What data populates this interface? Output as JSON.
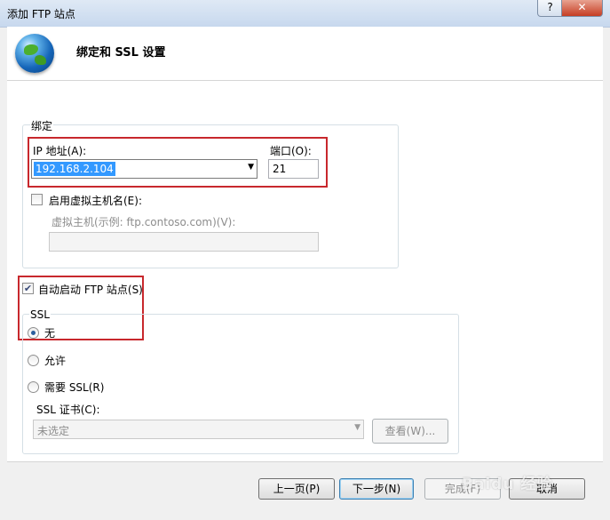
{
  "window": {
    "title": "添加 FTP 站点",
    "help_label": "?",
    "close_label": "✕"
  },
  "header": {
    "title": "绑定和 SSL 设置",
    "icon": "globe-icon"
  },
  "binding": {
    "group_label": "绑定",
    "ip_label": "IP 地址(A):",
    "ip_value": "192.168.2.104",
    "port_label": "端口(O):",
    "port_value": "21",
    "vhost_checkbox_label": "启用虚拟主机名(E):",
    "vhost_checked": false,
    "vhost_field_label": "虚拟主机(示例: ftp.contoso.com)(V):",
    "vhost_value": ""
  },
  "autostart": {
    "label": "自动启动 FTP 站点(S)",
    "checked": true
  },
  "ssl": {
    "group_label": "SSL",
    "options": [
      {
        "label": "无",
        "selected": true
      },
      {
        "label": "允许",
        "selected": false
      },
      {
        "label": "需要 SSL(R)",
        "selected": false
      }
    ],
    "cert_label": "SSL 证书(C):",
    "cert_value": "未选定",
    "view_button": "查看(W)..."
  },
  "footer": {
    "prev_button": "上一页(P)",
    "next_button": "下一步(N)",
    "finish_button": "完成(F)",
    "cancel_button": "取消"
  },
  "watermark": "Baidu 经验",
  "colors": {
    "highlight": "#c8282d",
    "selection": "#3399ff"
  }
}
